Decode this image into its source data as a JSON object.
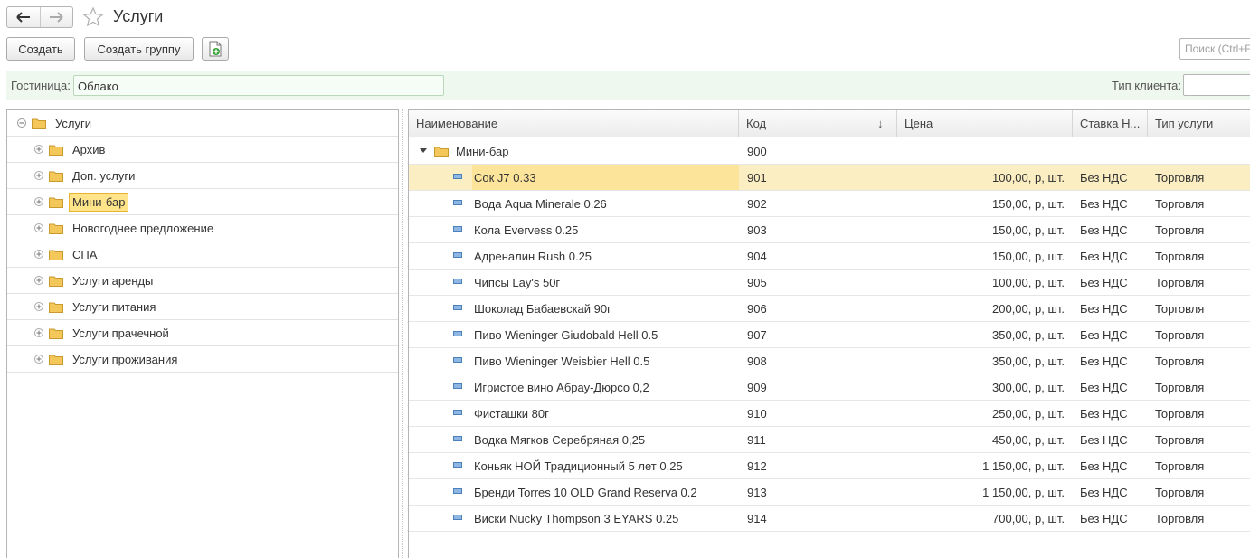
{
  "window": {
    "title": "Услуги"
  },
  "toolbar": {
    "create_label": "Создать",
    "create_group_label": "Создать группу",
    "search_placeholder": "Поиск (Ctrl+F)"
  },
  "filters": {
    "hotel_label": "Гостиница:",
    "hotel_value": "Облако",
    "client_type_label": "Тип клиента:",
    "client_type_value": ""
  },
  "tree": {
    "root": "Услуги",
    "items": [
      {
        "label": "Архив",
        "selected": false
      },
      {
        "label": "Доп. услуги",
        "selected": false
      },
      {
        "label": "Мини-бар",
        "selected": true
      },
      {
        "label": "Новогоднее предложение",
        "selected": false
      },
      {
        "label": "СПА",
        "selected": false
      },
      {
        "label": "Услуги аренды",
        "selected": false
      },
      {
        "label": "Услуги питания",
        "selected": false
      },
      {
        "label": "Услуги прачечной",
        "selected": false
      },
      {
        "label": "Услуги проживания",
        "selected": false
      }
    ]
  },
  "grid": {
    "columns": {
      "name": "Наименование",
      "code": "Код",
      "sort_indicator": "↓",
      "price": "Цена",
      "vat": "Ставка Н...",
      "type": "Тип услуги"
    },
    "group": {
      "name": "Мини-бар",
      "code": "900"
    },
    "rows": [
      {
        "name": "Сок J7 0.33",
        "code": "901",
        "price": "100,00, р, шт.",
        "vat": "Без НДС",
        "type": "Торговля",
        "current": true
      },
      {
        "name": "Вода Aqua Minerale 0.26",
        "code": "902",
        "price": "150,00, р, шт.",
        "vat": "Без НДС",
        "type": "Торговля"
      },
      {
        "name": "Кола Evervess 0.25",
        "code": "903",
        "price": "150,00, р, шт.",
        "vat": "Без НДС",
        "type": "Торговля"
      },
      {
        "name": "Адреналин Rush 0.25",
        "code": "904",
        "price": "150,00, р, шт.",
        "vat": "Без НДС",
        "type": "Торговля"
      },
      {
        "name": "Чипсы Lay's 50г",
        "code": "905",
        "price": "100,00, р, шт.",
        "vat": "Без НДС",
        "type": "Торговля"
      },
      {
        "name": "Шоколад Бабаевскай 90г",
        "code": "906",
        "price": "200,00, р, шт.",
        "vat": "Без НДС",
        "type": "Торговля"
      },
      {
        "name": "Пиво Wieninger Giudobald Hell 0.5",
        "code": "907",
        "price": "350,00, р, шт.",
        "vat": "Без НДС",
        "type": "Торговля"
      },
      {
        "name": "Пиво Wieninger Weisbier Hell 0.5",
        "code": "908",
        "price": "350,00, р, шт.",
        "vat": "Без НДС",
        "type": "Торговля"
      },
      {
        "name": "Игристое вино Абрау-Дюрсо 0,2",
        "code": "909",
        "price": "300,00, р, шт.",
        "vat": "Без НДС",
        "type": "Торговля"
      },
      {
        "name": "Фисташки 80г",
        "code": "910",
        "price": "250,00, р, шт.",
        "vat": "Без НДС",
        "type": "Торговля"
      },
      {
        "name": "Водка Мягков Серебряная 0,25",
        "code": "911",
        "price": "450,00, р, шт.",
        "vat": "Без НДС",
        "type": "Торговля"
      },
      {
        "name": "Коньяк НОЙ Традиционный 5 лет 0,25",
        "code": "912",
        "price": "1 150,00, р, шт.",
        "vat": "Без НДС",
        "type": "Торговля"
      },
      {
        "name": "Бренди Torres 10 OLD Grand Reserva 0.2",
        "code": "913",
        "price": "1 150,00, р, шт.",
        "vat": "Без НДС",
        "type": "Торговля"
      },
      {
        "name": "Виски Nucky Thompson 3 EYARS 0.25",
        "code": "914",
        "price": "700,00, р, шт.",
        "vat": "Без НДС",
        "type": "Торговля"
      }
    ]
  },
  "colors": {
    "filter_bar_bg": "#eef8ee",
    "selection_yellow": "#ffe48a",
    "current_row_bg": "#fbeec2",
    "folder_yellow": "#f3c75a"
  }
}
